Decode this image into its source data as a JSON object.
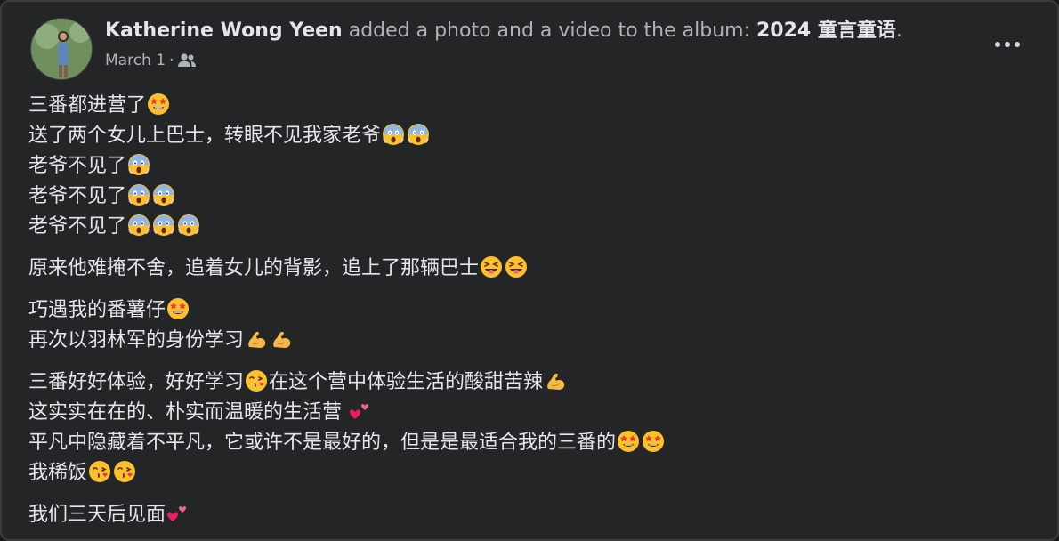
{
  "post": {
    "author": "Katherine Wong Yeen",
    "action_text": " added a photo and a video to the album: ",
    "album": "2024 童言童语",
    "album_suffix": ".",
    "date": "March 1",
    "separator": " · ",
    "audience_icon": "friends-icon",
    "more_icon": "more-options-icon"
  },
  "content": {
    "paragraphs": [
      [
        {
          "text": "三番都进营了",
          "emojis": [
            "star-struck"
          ]
        },
        {
          "text": "送了两个女儿上巴士，转眼不见我家老爷",
          "emojis": [
            "scream",
            "scream"
          ]
        },
        {
          "text": "老爷不见了",
          "emojis": [
            "scream"
          ]
        },
        {
          "text": "老爷不见了",
          "emojis": [
            "scream",
            "scream"
          ]
        },
        {
          "text": "老爷不见了",
          "emojis": [
            "scream",
            "scream",
            "scream"
          ]
        }
      ],
      [
        {
          "text": "原来他难掩不舍，追着女儿的背影，追上了那辆巴士",
          "emojis": [
            "squint-tongue",
            "squint-tongue"
          ]
        }
      ],
      [
        {
          "text": "巧遇我的番薯仔",
          "emojis": [
            "star-struck"
          ]
        },
        {
          "text": "再次以羽林军的身份学习",
          "emojis": [
            "flexed-biceps",
            "flexed-biceps"
          ]
        }
      ],
      [
        {
          "text": "三番好好体验，好好学习",
          "emojis": [
            "kiss-heart"
          ],
          "text2": "在这个营中体验生活的酸甜苦辣",
          "emojis2": [
            "flexed-biceps"
          ]
        },
        {
          "text": "这实实在在的、朴实而温暖的生活营 ",
          "emojis": [
            "two-hearts"
          ]
        },
        {
          "text": "平凡中隐藏着不平凡，它或许不是最好的，但是是最适合我的三番的",
          "emojis": [
            "star-struck",
            "star-struck"
          ]
        },
        {
          "text": "我稀饭",
          "emojis": [
            "kiss-heart",
            "kiss-heart"
          ]
        }
      ],
      [
        {
          "text": "我们三天后见面",
          "emojis": [
            "two-hearts"
          ]
        }
      ]
    ]
  }
}
